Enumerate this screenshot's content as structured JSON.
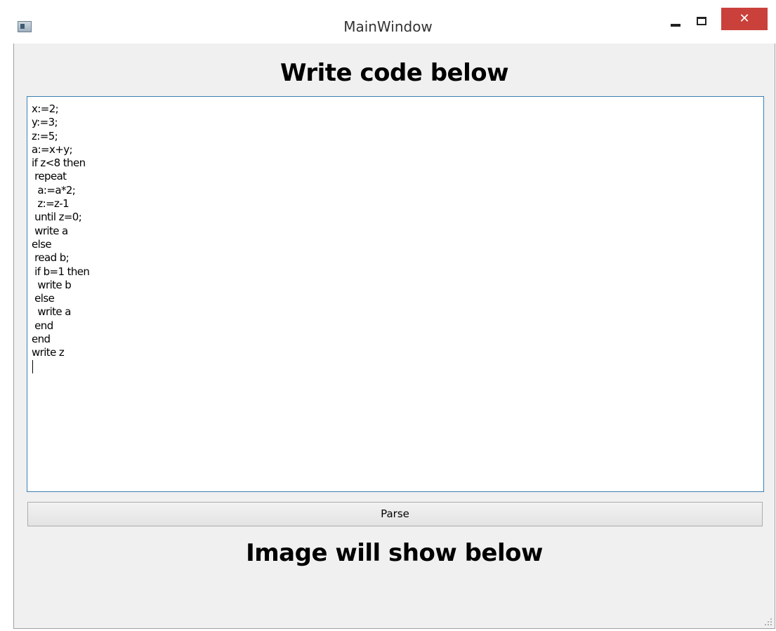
{
  "window": {
    "title": "MainWindow",
    "close_glyph": "✕"
  },
  "main": {
    "heading_top": "Write code below",
    "editor_lines": [
      "x:=2;",
      "y:=3;",
      "z:=5;",
      "a:=x+y;",
      "if z<8 then",
      " repeat",
      "  a:=a*2;",
      "  z:=z-1",
      " until z=0;",
      " write a",
      "else",
      " read b;",
      " if b=1 then",
      "  write b",
      " else",
      "  write a",
      " end",
      "end",
      "write z"
    ],
    "parse_label": "Parse",
    "heading_bottom": "Image will show below"
  },
  "icons": {
    "app": "app-icon",
    "minimize": "minimize-icon",
    "maximize": "maximize-icon",
    "close": "close-icon",
    "resize": "resize-grip-icon"
  },
  "colors": {
    "close_button": "#c9413a",
    "editor_border": "#3c7fb1",
    "client_background": "#f0f0f0"
  }
}
